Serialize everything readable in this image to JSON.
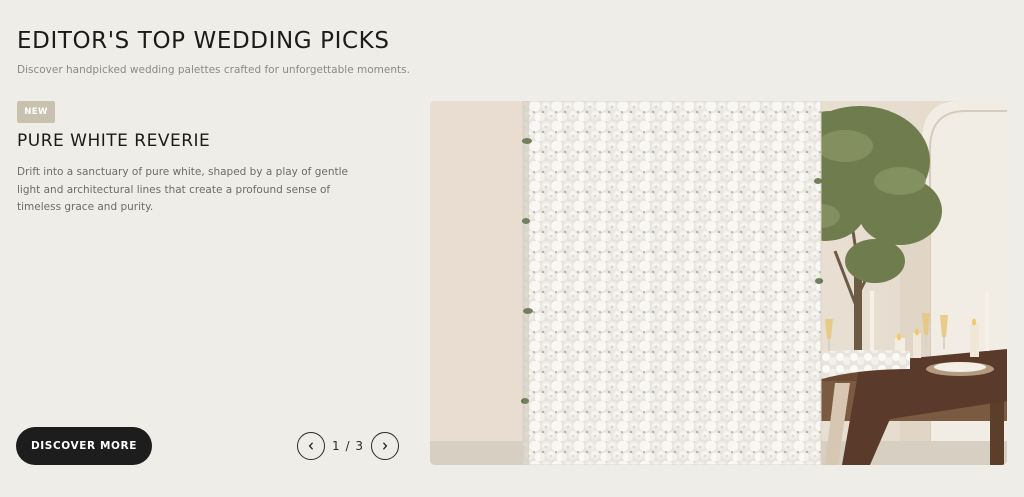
{
  "section": {
    "title": "EDITOR'S TOP WEDDING PICKS",
    "subtitle": "Discover handpicked wedding palettes crafted for unforgettable moments."
  },
  "slide": {
    "badge": "NEW",
    "title": "PURE WHITE REVERIE",
    "description": "Drift into a sanctuary of pure white, shaped by a play of gentle light and architectural lines that create a profound sense of timeless grace and purity.",
    "cta_label": "DISCOVER MORE"
  },
  "pager": {
    "counter": "1 / 3",
    "prev_icon": "chevron-left-icon",
    "next_icon": "chevron-right-icon"
  },
  "colors": {
    "page_background": "#efede8",
    "badge_background": "#c8c1ad",
    "cta_background": "#1d1d1d"
  }
}
